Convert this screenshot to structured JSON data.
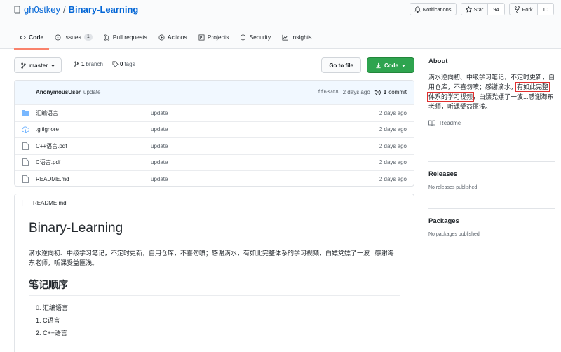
{
  "repo": {
    "owner": "gh0stkey",
    "separator": "/",
    "name": "Binary-Learning"
  },
  "header_buttons": {
    "notifications": "Notifications",
    "star": {
      "label": "Star",
      "count": "94"
    },
    "fork": {
      "label": "Fork",
      "count": "10"
    }
  },
  "tabs": [
    {
      "label": "Code"
    },
    {
      "label": "Issues",
      "badge": "1"
    },
    {
      "label": "Pull requests"
    },
    {
      "label": "Actions"
    },
    {
      "label": "Projects"
    },
    {
      "label": "Security"
    },
    {
      "label": "Insights"
    }
  ],
  "toolbar": {
    "branch": "master",
    "branches_count": "1",
    "branches_label": "branch",
    "tags_count": "0",
    "tags_label": "tags",
    "goto_file": "Go to file",
    "code": "Code"
  },
  "commit": {
    "author": "AnonymousUser",
    "message": "update",
    "sha": "ff637c8",
    "age": "2 days ago",
    "count": "1",
    "count_label": "commit"
  },
  "files": [
    {
      "icon": "folder-icon",
      "name": "汇编语言",
      "message": "update",
      "age": "2 days ago"
    },
    {
      "icon": "submodule-icon",
      "name": ".gitignore",
      "message": "update",
      "age": "2 days ago"
    },
    {
      "icon": "file-icon",
      "name": "C++语言.pdf",
      "message": "update",
      "age": "2 days ago"
    },
    {
      "icon": "file-icon",
      "name": "C语言.pdf",
      "message": "update",
      "age": "2 days ago"
    },
    {
      "icon": "file-icon",
      "name": "README.md",
      "message": "update",
      "age": "2 days ago"
    }
  ],
  "readme": {
    "filename": "README.md",
    "title": "Binary-Learning",
    "description": "滴水逆向初、中级学习笔记，不定时更新，自用仓库，不喜勿喷；感谢滴水，有如此完整体系的学习视频，白嫖党嫖了一波...感谢海东老师，听课受益匪浅。",
    "section_title": "笔记顺序",
    "items": [
      "0. 汇编语言",
      "1. C语言",
      "2. C++语言"
    ]
  },
  "sidebar": {
    "about_title": "About",
    "about_part1": "滴水逆向初、中级学习笔记，不定时更新，自用仓库，不喜勿喷；感谢滴水，",
    "about_highlight": "有如此完整体系的学习视频",
    "about_part2": "，白嫖党嫖了一波...感谢海东老师，听课受益匪浅。",
    "readme_link": "Readme",
    "releases_title": "Releases",
    "releases_text": "No releases published",
    "packages_title": "Packages",
    "packages_text": "No packages published"
  },
  "colors": {
    "link": "#0366d6",
    "primary_button": "#2ea44f",
    "active_tab_underline": "#f9826c",
    "highlight_box": "#e0302f"
  }
}
